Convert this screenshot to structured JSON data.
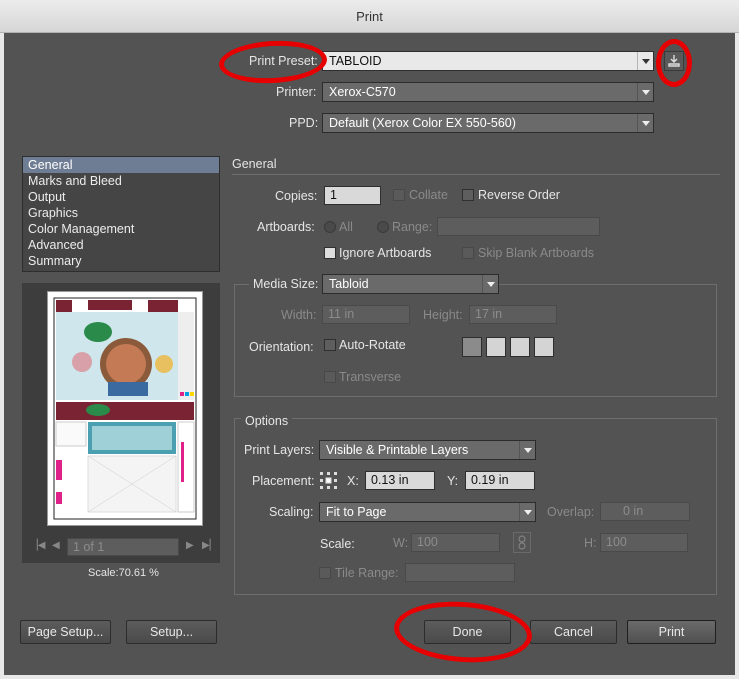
{
  "window": {
    "title": "Print"
  },
  "preset": {
    "label": "Print Preset:",
    "value": "TABLOID"
  },
  "printer": {
    "label": "Printer:",
    "value": "Xerox-C570"
  },
  "ppd": {
    "label": "PPD:",
    "value": "Default (Xerox Color EX 550-560)"
  },
  "sidebar": {
    "items": [
      {
        "label": "General",
        "selected": true
      },
      {
        "label": "Marks and Bleed"
      },
      {
        "label": "Output"
      },
      {
        "label": "Graphics"
      },
      {
        "label": "Color Management"
      },
      {
        "label": "Advanced"
      },
      {
        "label": "Summary"
      }
    ]
  },
  "general": {
    "heading": "General",
    "copies_label": "Copies:",
    "copies_value": "1",
    "collate_label": "Collate",
    "reverse_label": "Reverse Order",
    "artboards_label": "Artboards:",
    "all_label": "All",
    "range_label": "Range:",
    "ignore_label": "Ignore Artboards",
    "skip_label": "Skip Blank Artboards"
  },
  "media": {
    "size_label": "Media Size:",
    "size_value": "Tabloid",
    "width_label": "Width:",
    "width_value": "11 in",
    "height_label": "Height:",
    "height_value": "17 in",
    "orientation_label": "Orientation:",
    "autorotate_label": "Auto-Rotate",
    "transverse_label": "Transverse"
  },
  "options": {
    "heading": "Options",
    "layers_label": "Print Layers:",
    "layers_value": "Visible & Printable Layers",
    "placement_label": "Placement:",
    "x_label": "X:",
    "x_value": "0.13 in",
    "y_label": "Y:",
    "y_value": "0.19 in",
    "scaling_label": "Scaling:",
    "scaling_value": "Fit to Page",
    "overlap_label": "Overlap:",
    "overlap_value": "0 in",
    "scale_label": "Scale:",
    "w_label": "W:",
    "w_value": "100",
    "h_label": "H:",
    "h_value": "100",
    "tile_label": "Tile Range:"
  },
  "preview": {
    "page_value": "1 of 1",
    "scale_text": "Scale:70.61 %"
  },
  "buttons": {
    "page_setup": "Page Setup...",
    "setup": "Setup...",
    "done": "Done",
    "cancel": "Cancel",
    "print": "Print"
  },
  "colors": {
    "annotation": "#e60000",
    "selection": "#6e7d93",
    "panel": "#535353"
  }
}
